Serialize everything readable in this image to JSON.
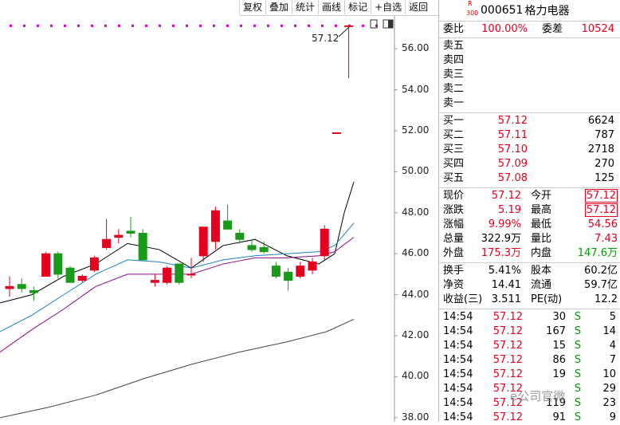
{
  "toolbar": {
    "buttons": [
      "复权",
      "叠加",
      "统计",
      "画线",
      "标记",
      "+自选",
      "返回"
    ]
  },
  "chart_data": {
    "type": "candlestick",
    "y_ticks": [
      "56.00",
      "54.00",
      "52.00",
      "50.00",
      "48.00",
      "46.00",
      "44.00",
      "42.00",
      "40.00",
      "38.00"
    ],
    "ylim": [
      37.8,
      57.6
    ],
    "last_price_label": "57.12",
    "limit_up_line": 57.12,
    "candles": [
      {
        "o": 44.3,
        "h": 44.9,
        "l": 43.9,
        "c": 44.4
      },
      {
        "o": 44.5,
        "h": 44.8,
        "l": 44.1,
        "c": 44.3
      },
      {
        "o": 44.2,
        "h": 44.4,
        "l": 43.7,
        "c": 44.1
      },
      {
        "o": 44.9,
        "h": 46.1,
        "l": 44.9,
        "c": 46.0
      },
      {
        "o": 46.0,
        "h": 46.1,
        "l": 44.8,
        "c": 45.0
      },
      {
        "o": 45.3,
        "h": 45.4,
        "l": 44.6,
        "c": 44.6
      },
      {
        "o": 44.7,
        "h": 45.0,
        "l": 44.6,
        "c": 44.9
      },
      {
        "o": 45.2,
        "h": 45.9,
        "l": 45.1,
        "c": 45.8
      },
      {
        "o": 46.3,
        "h": 47.7,
        "l": 46.2,
        "c": 46.7
      },
      {
        "o": 46.8,
        "h": 47.2,
        "l": 46.5,
        "c": 46.9
      },
      {
        "o": 47.1,
        "h": 47.8,
        "l": 46.8,
        "c": 47.0
      },
      {
        "o": 47.0,
        "h": 47.2,
        "l": 45.8,
        "c": 45.7
      },
      {
        "o": 44.6,
        "h": 45.0,
        "l": 44.4,
        "c": 44.7
      },
      {
        "o": 44.6,
        "h": 45.4,
        "l": 44.5,
        "c": 45.3
      },
      {
        "o": 45.5,
        "h": 45.5,
        "l": 44.5,
        "c": 44.6
      },
      {
        "o": 45.0,
        "h": 45.8,
        "l": 44.8,
        "c": 45.0
      },
      {
        "o": 45.9,
        "h": 46.8,
        "l": 45.6,
        "c": 47.3
      },
      {
        "o": 46.6,
        "h": 48.3,
        "l": 46.2,
        "c": 48.1
      },
      {
        "o": 47.6,
        "h": 48.4,
        "l": 47.3,
        "c": 47.2
      },
      {
        "o": 47.0,
        "h": 47.2,
        "l": 46.5,
        "c": 46.7
      },
      {
        "o": 46.4,
        "h": 46.7,
        "l": 46.1,
        "c": 46.2
      },
      {
        "o": 46.3,
        "h": 46.6,
        "l": 46.0,
        "c": 46.1
      },
      {
        "o": 45.4,
        "h": 45.6,
        "l": 44.8,
        "c": 44.9
      },
      {
        "o": 45.1,
        "h": 45.3,
        "l": 44.2,
        "c": 44.7
      },
      {
        "o": 44.9,
        "h": 45.6,
        "l": 44.8,
        "c": 45.4
      },
      {
        "o": 45.2,
        "h": 45.8,
        "l": 45.0,
        "c": 45.6
      },
      {
        "o": 45.9,
        "h": 47.4,
        "l": 45.7,
        "c": 47.2
      },
      {
        "o": 51.9,
        "h": 51.9,
        "l": 51.9,
        "c": 51.9
      },
      {
        "o": 57.12,
        "h": 57.12,
        "l": 54.56,
        "c": 57.12
      }
    ],
    "ma_series": [
      {
        "color": "#000000",
        "values": [
          [
            0,
            43.6
          ],
          [
            40,
            44.0
          ],
          [
            80,
            44.9
          ],
          [
            120,
            45.5
          ],
          [
            160,
            46.5
          ],
          [
            200,
            46.2
          ],
          [
            240,
            45.3
          ],
          [
            280,
            46.4
          ],
          [
            320,
            46.7
          ],
          [
            360,
            45.9
          ],
          [
            400,
            45.5
          ],
          [
            420,
            46.0
          ],
          [
            432,
            48.0
          ],
          [
            444,
            49.5
          ]
        ]
      },
      {
        "color": "#1c84c6",
        "values": [
          [
            0,
            42.2
          ],
          [
            40,
            43.0
          ],
          [
            80,
            44.0
          ],
          [
            120,
            45.0
          ],
          [
            160,
            45.7
          ],
          [
            200,
            45.6
          ],
          [
            240,
            45.3
          ],
          [
            280,
            45.7
          ],
          [
            320,
            45.9
          ],
          [
            360,
            46.0
          ],
          [
            400,
            46.1
          ],
          [
            420,
            46.4
          ],
          [
            444,
            47.5
          ]
        ]
      },
      {
        "color": "#8a0a8a",
        "values": [
          [
            0,
            41.2
          ],
          [
            40,
            42.3
          ],
          [
            80,
            43.3
          ],
          [
            120,
            44.4
          ],
          [
            160,
            45.0
          ],
          [
            200,
            45.0
          ],
          [
            240,
            45.0
          ],
          [
            280,
            45.5
          ],
          [
            320,
            45.8
          ],
          [
            360,
            45.8
          ],
          [
            400,
            45.9
          ],
          [
            420,
            46.1
          ],
          [
            444,
            46.8
          ]
        ]
      },
      {
        "color": "#444444",
        "values": [
          [
            0,
            38.0
          ],
          [
            60,
            38.5
          ],
          [
            120,
            39.1
          ],
          [
            180,
            39.9
          ],
          [
            240,
            40.6
          ],
          [
            300,
            41.2
          ],
          [
            360,
            41.7
          ],
          [
            410,
            42.2
          ],
          [
            444,
            42.8
          ]
        ]
      }
    ]
  },
  "stock": {
    "badge_r": "R",
    "badge_num": "300",
    "code": "000651",
    "name": "格力电器"
  },
  "weibi": {
    "label1": "委比",
    "value1": "100.00%",
    "label2": "委差",
    "value2": "10524"
  },
  "asks": [
    {
      "label": "卖五",
      "price": "",
      "vol": ""
    },
    {
      "label": "卖四",
      "price": "",
      "vol": ""
    },
    {
      "label": "卖三",
      "price": "",
      "vol": ""
    },
    {
      "label": "卖二",
      "price": "",
      "vol": ""
    },
    {
      "label": "卖一",
      "price": "",
      "vol": ""
    }
  ],
  "bids": [
    {
      "label": "买一",
      "price": "57.12",
      "vol": "6624"
    },
    {
      "label": "买二",
      "price": "57.11",
      "vol": "787"
    },
    {
      "label": "买三",
      "price": "57.10",
      "vol": "2718"
    },
    {
      "label": "买四",
      "price": "57.09",
      "vol": "270"
    },
    {
      "label": "买五",
      "price": "57.08",
      "vol": "125"
    }
  ],
  "quote": [
    {
      "l1": "现价",
      "v1": "57.12",
      "c1": "red",
      "l2": "今开",
      "v2": "57.12",
      "c2": "red",
      "box2": true
    },
    {
      "l1": "涨跌",
      "v1": "5.19",
      "c1": "red",
      "l2": "最高",
      "v2": "57.12",
      "c2": "red",
      "box2": true
    },
    {
      "l1": "涨幅",
      "v1": "9.99%",
      "c1": "red",
      "l2": "最低",
      "v2": "54.56",
      "c2": "red",
      "box2": false
    },
    {
      "l1": "总量",
      "v1": "322.9万",
      "c1": "black",
      "l2": "量比",
      "v2": "7.43",
      "c2": "red",
      "box2": false
    },
    {
      "l1": "外盘",
      "v1": "175.3万",
      "c1": "red",
      "l2": "内盘",
      "v2": "147.6万",
      "c2": "green",
      "box2": false
    }
  ],
  "fundamentals": [
    {
      "l1": "换手",
      "v1": "5.41%",
      "l2": "股本",
      "v2": "60.2亿"
    },
    {
      "l1": "净资",
      "v1": "14.41",
      "l2": "流通",
      "v2": "59.7亿"
    },
    {
      "l1": "收益(三)",
      "v1": "3.511",
      "l2": "PE(动)",
      "v2": "12.2"
    }
  ],
  "ticks": [
    {
      "time": "14:54",
      "price": "57.12",
      "vol": "30",
      "side": "S",
      "count": "5"
    },
    {
      "time": "14:54",
      "price": "57.12",
      "vol": "167",
      "side": "S",
      "count": "14"
    },
    {
      "time": "14:54",
      "price": "57.12",
      "vol": "15",
      "side": "S",
      "count": "4"
    },
    {
      "time": "14:54",
      "price": "57.12",
      "vol": "86",
      "side": "S",
      "count": "7"
    },
    {
      "time": "14:54",
      "price": "57.12",
      "vol": "19",
      "side": "S",
      "count": "10"
    },
    {
      "time": "14:54",
      "price": "57.12",
      "vol": "",
      "side": "S",
      "count": "29"
    },
    {
      "time": "14:54",
      "price": "57.12",
      "vol": "119",
      "side": "S",
      "count": "23"
    },
    {
      "time": "14:54",
      "price": "57.12",
      "vol": "91",
      "side": "S",
      "count": "9"
    }
  ],
  "watermark": "e公司官微"
}
